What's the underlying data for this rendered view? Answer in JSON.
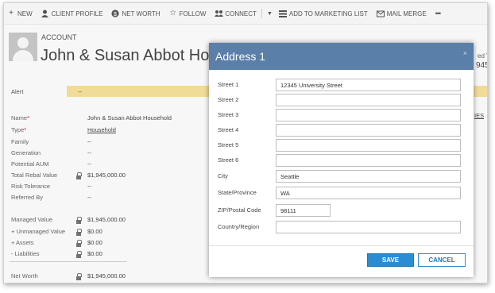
{
  "commandbar": {
    "items": [
      {
        "icon": "plus-icon",
        "label": "NEW"
      },
      {
        "icon": "person-icon",
        "label": "CLIENT PROFILE"
      },
      {
        "icon": "dollar-circle-icon",
        "label": "NET WORTH"
      },
      {
        "icon": "star-icon",
        "label": "FOLLOW"
      },
      {
        "icon": "connect-icon",
        "label": "CONNECT"
      },
      {
        "icon": "chevron-down-icon",
        "label": ""
      },
      {
        "icon": "list-icon",
        "label": "ADD TO MARKETING LIST"
      },
      {
        "icon": "mail-merge-icon",
        "label": "MAIL MERGE"
      },
      {
        "icon": "more-icon",
        "label": "•••"
      }
    ]
  },
  "header": {
    "entity_type": "ACCOUNT",
    "title": "John & Susan Abbot Hou",
    "right_label": "ed V",
    "right_value": "945,"
  },
  "alert": {
    "label": "Alert",
    "value": "--"
  },
  "fields": [
    {
      "label": "Name",
      "required": "*",
      "value": "John & Susan Abbot Household",
      "lock": false,
      "link": false
    },
    {
      "label": "Type",
      "required": "*",
      "value": "Household",
      "lock": false,
      "link": true
    },
    {
      "label": "Family",
      "required": "",
      "value": "--",
      "lock": false,
      "link": false
    },
    {
      "label": "Generation",
      "required": "",
      "value": "--",
      "lock": false,
      "link": false
    },
    {
      "label": "Potential AUM",
      "required": "",
      "value": "--",
      "lock": false,
      "link": false
    },
    {
      "label": "Total Rebal Value",
      "required": "",
      "value": "$1,945,000.00",
      "lock": true,
      "link": false
    },
    {
      "label": "Risk Tolerance",
      "required": "",
      "value": "--",
      "lock": false,
      "link": false
    },
    {
      "label": "Referred By",
      "required": "",
      "value": "--",
      "lock": false,
      "link": false
    },
    {
      "label": "Managed Value",
      "required": "",
      "value": "$1,945,000.00",
      "lock": true,
      "link": false
    },
    {
      "label": "+ Unmanaged Value",
      "required": "",
      "value": "$0.00",
      "lock": true,
      "link": false
    },
    {
      "label": "+ Assets",
      "required": "",
      "value": "$0.00",
      "lock": true,
      "link": false
    },
    {
      "label": "- Liabilities",
      "required": "",
      "value": "$0.00",
      "lock": true,
      "link": false
    },
    {
      "label": "Net Worth",
      "required": "",
      "value": "$1,945,000.00",
      "lock": true,
      "link": false
    }
  ],
  "side_link": "IES",
  "modal": {
    "title": "Address 1",
    "close": "×",
    "rows": [
      {
        "label": "Street 1",
        "value": "12345 University Street"
      },
      {
        "label": "Street 2",
        "value": ""
      },
      {
        "label": "Street 3",
        "value": ""
      },
      {
        "label": "Street 4",
        "value": ""
      },
      {
        "label": "Street 5",
        "value": ""
      },
      {
        "label": "Street 6",
        "value": ""
      },
      {
        "label": "City",
        "value": "Seattle"
      },
      {
        "label": "State/Province",
        "value": "WA"
      },
      {
        "label": "ZIP/Postal Code",
        "value": "98111"
      },
      {
        "label": "Country/Region",
        "value": ""
      }
    ],
    "save_label": "SAVE",
    "cancel_label": "CANCEL"
  },
  "colors": {
    "modal_header": "#5a7fa8",
    "save_button": "#2a8dd4",
    "alert_bar": "#efd98f"
  }
}
